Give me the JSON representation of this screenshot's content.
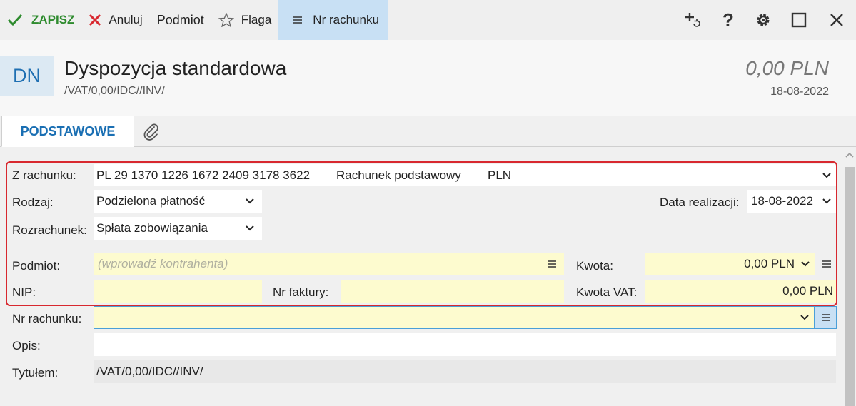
{
  "toolbar": {
    "save_label": "ZAPISZ",
    "cancel_label": "Anuluj",
    "subject_label": "Podmiot",
    "flag_label": "Flaga",
    "account_label": "Nr rachunku"
  },
  "header": {
    "badge": "DN",
    "title": "Dyspozycja standardowa",
    "subtitle": "/VAT/0,00/IDC//INV/",
    "amount": "0,00 PLN",
    "date": "18-08-2022"
  },
  "tabs": {
    "basic": "PODSTAWOWE"
  },
  "form": {
    "from_account_label": "Z rachunku:",
    "from_account_value": "PL 29 1370 1226 1672 2409 3178 3622",
    "from_account_type": "Rachunek podstawowy",
    "from_account_currency": "PLN",
    "kind_label": "Rodzaj:",
    "kind_value": "Podzielona płatność",
    "date_label": "Data realizacji:",
    "date_value": "18-08-2022",
    "settlement_label": "Rozrachunek:",
    "settlement_value": "Spłata zobowiązania",
    "subject_label": "Podmiot:",
    "subject_placeholder": "(wprowadź kontrahenta)",
    "amount_label": "Kwota:",
    "amount_value": "0,00 PLN",
    "nip_label": "NIP:",
    "nip_value": "",
    "invoice_label": "Nr faktury:",
    "invoice_value": "",
    "vat_label": "Kwota VAT:",
    "vat_value": "0,00 PLN",
    "account_label": "Nr rachunku:",
    "account_value": "",
    "desc_label": "Opis:",
    "desc_value": "",
    "title_label": "Tytułem:",
    "title_value": "/VAT/0,00/IDC//INV/"
  },
  "colors": {
    "accent": "#1a6fb3",
    "save_green": "#2e8b2e",
    "cancel_red": "#d8282f",
    "highlight_border": "#d8282f",
    "yellow_field": "#fdfbcf"
  }
}
